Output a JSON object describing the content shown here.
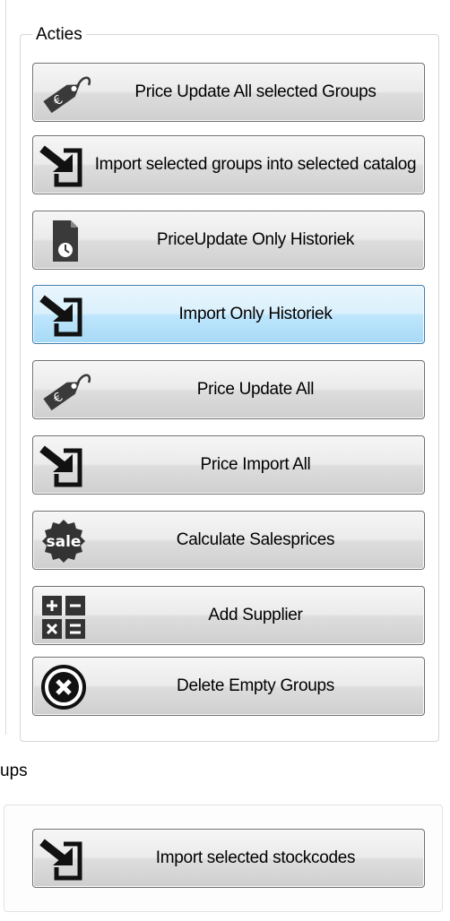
{
  "actions_group": {
    "title": "Acties",
    "buttons": [
      {
        "label": "Price Update All selected Groups",
        "icon": "euro-tag-icon"
      },
      {
        "label": "Import selected groups into selected catalog",
        "icon": "import-arrow-icon"
      },
      {
        "label": "PriceUpdate Only Historiek",
        "icon": "history-document-icon"
      },
      {
        "label": "Import Only Historiek",
        "icon": "import-arrow-icon",
        "state": "hovered"
      },
      {
        "label": "Price Update All",
        "icon": "euro-tag-icon"
      },
      {
        "label": "Price Import All",
        "icon": "import-arrow-icon"
      },
      {
        "label": "Calculate Salesprices",
        "icon": "sale-badge-icon"
      },
      {
        "label": "Add Supplier",
        "icon": "calculator-icon"
      },
      {
        "label": "Delete Empty Groups",
        "icon": "delete-circle-icon"
      }
    ]
  },
  "groups_section": {
    "label": "ups",
    "button": {
      "label": "Import selected stockcodes",
      "icon": "import-arrow-icon"
    }
  },
  "colors": {
    "hover_border": "#3c7fb1",
    "hover_fill": "#bee6fd",
    "button_border": "#707070"
  }
}
